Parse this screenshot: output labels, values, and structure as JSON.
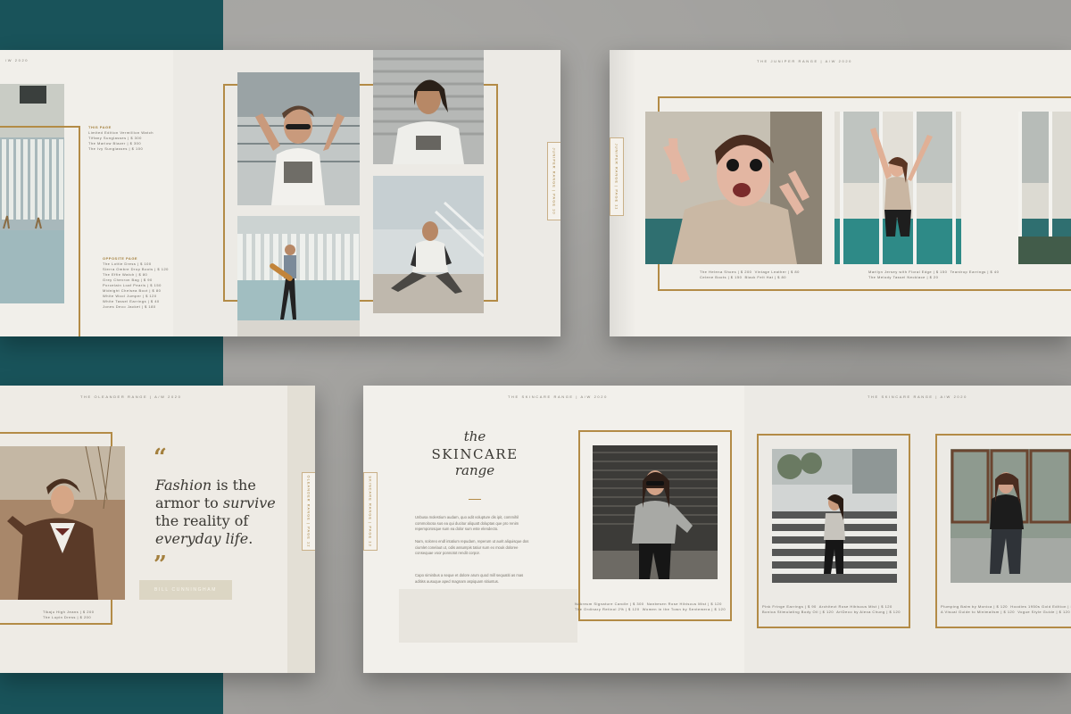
{
  "spread1": {
    "left_page_header": "/W 2020",
    "vertical_tab": "JUNIPER RANGE | PAGE 10",
    "this_page_title": "THIS PAGE",
    "this_page_items": [
      "Limited Edition Vermillion Watch",
      "Tiffany Sunglasses | $ 300",
      "The Marlow Blazer | $ 300",
      "The Ivy Sunglasses | $ 100"
    ],
    "opposite_page_title": "OPPOSITE PAGE",
    "opposite_page_items": [
      "The Lottie Dress | $ 100",
      "Sierra Ombre Drop Boots | $ 120",
      "The Effie Watch | $ 80",
      "Grey Chevron Bag | $ 90",
      "Porcelain Loaf Pearls | $ 150",
      "Midnight Chelsea Boot | $ 80",
      "White Wool Jumper | $ 120",
      "White Tassel Earrings | $ 40",
      "Jones Deco Jacket | $ 180"
    ]
  },
  "spread2": {
    "header": "THE JUNIPER RANGE | A/W 2020",
    "vertical_tab": "JUNIPER RANGE | PAGE 11",
    "caption_left": "The Helena Shoes | $ 200  Vintage Leather | $ 80\nCelene Boots | $ 150  Black Felt Hat | $ 80",
    "caption_right": "Marilyn Jersey with Floral Edge | $ 150  Teardrop Earrings | $ 40\nThe Melody Tassel Necklace | $ 20"
  },
  "spread3": {
    "header": "THE OLEANDER RANGE | A/W 2020",
    "vertical_tab": "OLEANDER RANGE | PAGE 12",
    "quote_open": "“",
    "quote_close": "”",
    "quote_line1_italic": "Fashion",
    "quote_line1_rest": " is the",
    "quote_line2_pre": "armor to ",
    "quote_line2_italic": "survive",
    "quote_line3": "the reality of",
    "quote_line4_italic": "everyday life",
    "quote_line4_end": ".",
    "author": "BILL CUNNINGHAM",
    "caption": "Tikaju High Jeans | $ 200\nThe Lupin Dress | $ 200"
  },
  "spread4": {
    "header_left": "THE SKINCARE RANGE | A/W 2020",
    "header_right": "THE SKINCARE RANGE | A/W 2020",
    "vertical_tab": "SKINCARE RANGE | PAGE 13",
    "title_the": "the",
    "title_main": "SKINCARE",
    "title_range": "range",
    "body_p1": "Unbusa molestium audam, quo adit volupture dis ipit, commihil commolocsa sus ea qui ducitur aliquatt doluptas que pro renim repemporosque sum ea dolor sum este elendecto.",
    "body_p2": "Nam, soloreo endl intatium repudam, reperum ut aurit aliquisque dos ciumlet conelaut ut, odis assumpis tatiur sum ex mouk doloree consequae voor ponnotot rendit corpor.",
    "body_p3": "Capo siminbus a seque et dolore arum quod mill sequatiti as mas aditiss ausuque aped magnam aspiquam sitiuntus.",
    "caption1": "Nakreum Signature Candle | $ 300  Nanbesen Rose Hibiscus Mist | $ 120\nThe Ordinary Retinol 2% | $ 120  Women in the Town by Sentemera | $ 120",
    "caption2": "Pink Fringe Earrings | $ 90  Architect Rose Hibiscus Mist | $ 120\nBonica Stimulating Body Oil | $ 120  ArtDeco by Alexa Chung | $ 120",
    "caption3": "Plumping Balm by Monica | $ 120  Hoodies 1950s Gold Edition | $ 120\nA Visual Guide to Minimalism | $ 120  Vogue Style Guide | $ 120"
  },
  "colors": {
    "teal": "#19535a",
    "gold": "#b38b46",
    "paper": "#f1efea",
    "concrete": "#a09f9c"
  }
}
